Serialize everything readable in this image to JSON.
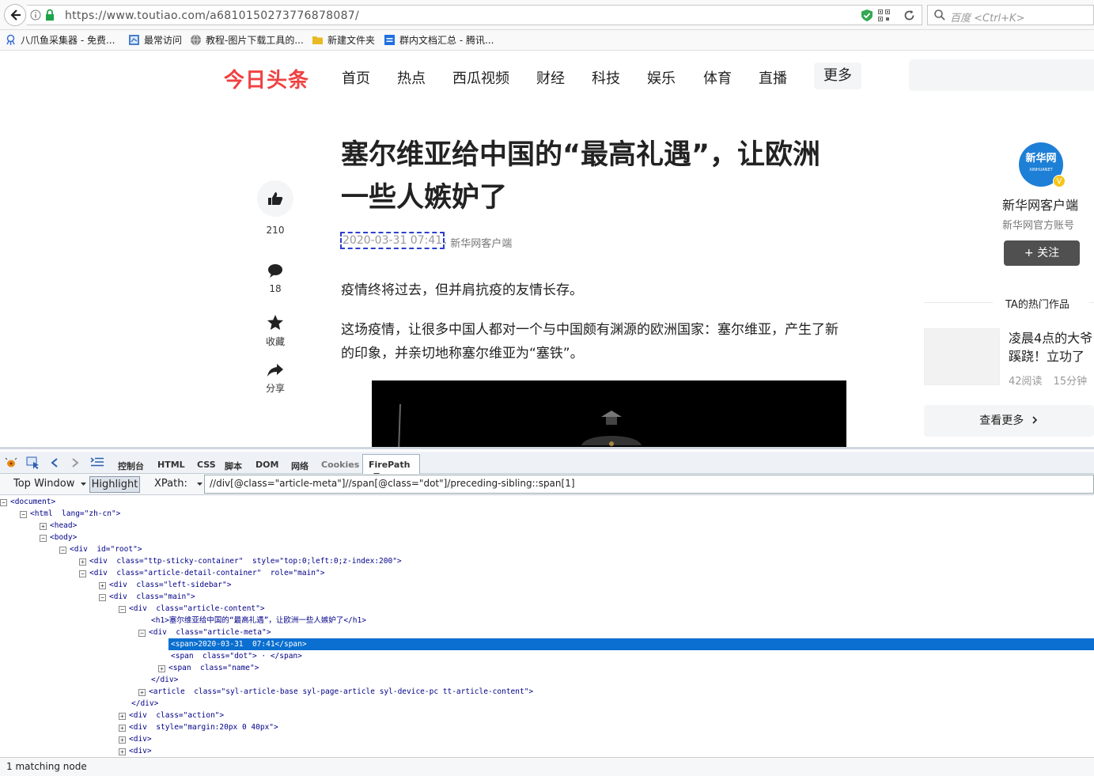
{
  "browser": {
    "url": "https://www.toutiao.com/a6810150273776878087/",
    "search_placeholder": "百度 <Ctrl+K>",
    "bookmarks": [
      {
        "label": "八爪鱼采集器 - 免费..."
      },
      {
        "label": "最常访问"
      },
      {
        "label": "教程-图片下载工具的..."
      },
      {
        "label": "新建文件夹"
      },
      {
        "label": "群内文档汇总 - 腾讯..."
      }
    ]
  },
  "site": {
    "logo": "今日头条",
    "nav": [
      "首页",
      "热点",
      "西瓜视频",
      "财经",
      "科技",
      "娱乐",
      "体育",
      "直播"
    ],
    "more": "更多"
  },
  "article": {
    "title_line1": "塞尔维亚给中国的“最高礼遇”，让欧洲",
    "title_line2": "一些人嫉妒了",
    "time": "2020-03-31 07:41",
    "dot": "·",
    "author": "新华网客户端",
    "para1": "疫情终将过去，但并肩抗疫的友情长存。",
    "para2_line1": "这场疫情，让很多中国人都对一个与中国颇有渊源的欧洲国家：塞尔维亚，产生了新",
    "para2_line2": "的印象，并亲切地称塞尔维亚为“塞铁”。"
  },
  "actions": {
    "likes": "210",
    "comments": "18",
    "collect": "收藏",
    "share": "分享"
  },
  "profile": {
    "avatar_text": "新华网",
    "avatar_sub": "XINHUANET",
    "badge": "V",
    "name": "新华网客户端",
    "desc": "新华网官方账号",
    "follow": "+ 关注",
    "hot_title": "TA的热门作品",
    "hot_item_line1": "凌晨4点的大爷",
    "hot_item_line2": "蹊跷！立功了",
    "hot_reads": "42阅读",
    "hot_time": "15分钟",
    "see_more": "查看更多"
  },
  "devtools": {
    "tabs": [
      "控制台",
      "HTML",
      "CSS",
      "脚本",
      "DOM",
      "网络",
      "Cookies"
    ],
    "active_tab": "FirePath",
    "top_window": "Top Window",
    "highlight": "Highlight",
    "xpath_label": "XPath:",
    "xpath_value": "//div[@class=\"article-meta\"]//span[@class=\"dot\"]/preceding-sibling::span[1]",
    "status": "1 matching node",
    "tree": [
      {
        "ind": 0,
        "exp": "-",
        "html": "&lt;document&gt;"
      },
      {
        "ind": 1,
        "exp": "-",
        "html": "&lt;html  lang=\"zh-cn\"&gt;"
      },
      {
        "ind": 2,
        "exp": "+",
        "html": "&lt;head&gt;"
      },
      {
        "ind": 2,
        "exp": "-",
        "html": "&lt;body&gt;"
      },
      {
        "ind": 3,
        "exp": "-",
        "html": "&lt;div  id=\"root\"&gt;"
      },
      {
        "ind": 4,
        "exp": "+",
        "html": "&lt;div  class=\"ttp-sticky-container\"  style=\"top:0;left:0;z-index:200\"&gt;"
      },
      {
        "ind": 4,
        "exp": "-",
        "html": "&lt;div  class=\"article-detail-container\"  role=\"main\"&gt;"
      },
      {
        "ind": 5,
        "exp": "+",
        "html": "&lt;div  class=\"left-sidebar\"&gt;"
      },
      {
        "ind": 5,
        "exp": "-",
        "html": "&lt;div  class=\"main\"&gt;"
      },
      {
        "ind": 6,
        "exp": "-",
        "html": "&lt;div  class=\"article-content\"&gt;"
      },
      {
        "ind": 7,
        "exp": "",
        "html": "&lt;h1&gt;塞尔维亚给中国的“最高礼遇”，让欧洲一些人嫉妒了&lt;/h1&gt;"
      },
      {
        "ind": 7,
        "exp": "-",
        "html": "&lt;div  class=\"article-meta\"&gt;"
      },
      {
        "ind": 8,
        "exp": "",
        "html": "&lt;span&gt;2020-03-31  07:41&lt;/span&gt;",
        "selected": true
      },
      {
        "ind": 8,
        "exp": "",
        "html": "&lt;span  class=\"dot\"&gt; · &lt;/span&gt;"
      },
      {
        "ind": 8,
        "exp": "+",
        "html": "&lt;span  class=\"name\"&gt;"
      },
      {
        "ind": 7,
        "exp": "",
        "html": "&lt;/div&gt;"
      },
      {
        "ind": 7,
        "exp": "+",
        "html": "&lt;article  class=\"syl-article-base syl-page-article syl-device-pc tt-article-content\"&gt;"
      },
      {
        "ind": 6,
        "exp": "",
        "html": "&lt;/div&gt;"
      },
      {
        "ind": 6,
        "exp": "+",
        "html": "&lt;div  class=\"action\"&gt;"
      },
      {
        "ind": 6,
        "exp": "+",
        "html": "&lt;div  style=\"margin:20px 0 40px\"&gt;"
      },
      {
        "ind": 6,
        "exp": "+",
        "html": "&lt;div&gt;"
      },
      {
        "ind": 6,
        "exp": "+",
        "html": "&lt;div&gt;"
      }
    ]
  }
}
